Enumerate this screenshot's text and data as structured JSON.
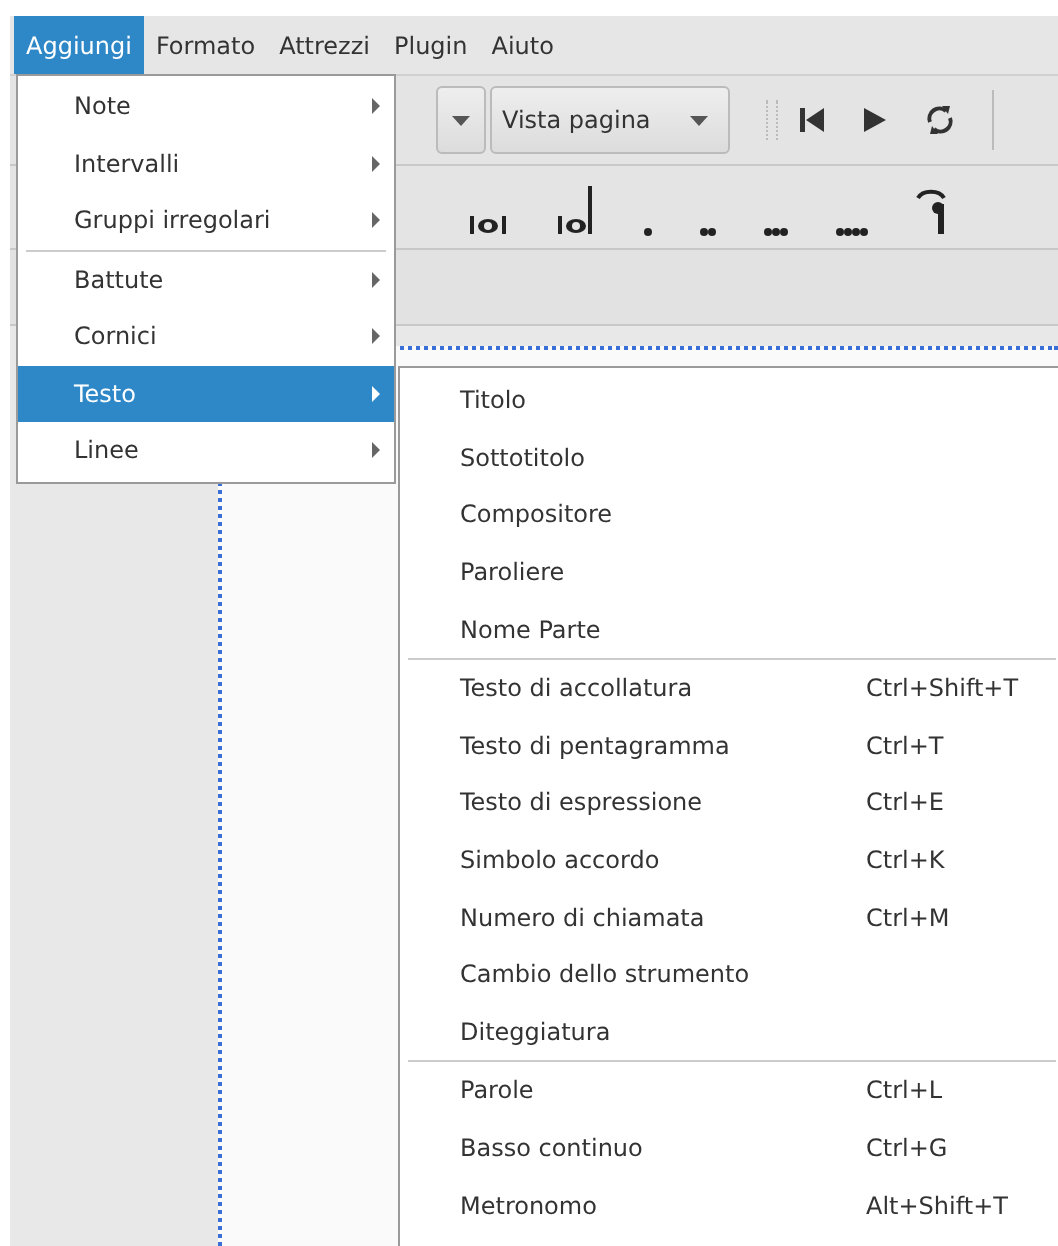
{
  "menubar": [
    {
      "label": "Aggiungi",
      "selected": true
    },
    {
      "label": "Formato",
      "selected": false
    },
    {
      "label": "Attrezzi",
      "selected": false
    },
    {
      "label": "Plugin",
      "selected": false
    },
    {
      "label": "Aiuto",
      "selected": false
    }
  ],
  "toolbar": {
    "view_mode": "Vista pagina"
  },
  "menu": {
    "sections": [
      {
        "items": [
          {
            "label": "Note",
            "selected": false
          },
          {
            "label": "Intervalli",
            "selected": false
          },
          {
            "label": "Gruppi irregolari",
            "selected": false
          }
        ]
      },
      {
        "items": [
          {
            "label": "Battute",
            "selected": false
          },
          {
            "label": "Cornici",
            "selected": false
          },
          {
            "label": "Testo",
            "selected": true
          },
          {
            "label": "Linee",
            "selected": false
          }
        ]
      }
    ]
  },
  "submenu": {
    "sections": [
      {
        "items": [
          {
            "label": "Titolo"
          },
          {
            "label": "Sottotitolo"
          },
          {
            "label": "Compositore"
          },
          {
            "label": "Paroliere"
          },
          {
            "label": "Nome Parte"
          }
        ]
      },
      {
        "items": [
          {
            "label": "Testo di accollatura",
            "shortcut": "Ctrl+Shift+T"
          },
          {
            "label": "Testo di pentagramma",
            "shortcut": "Ctrl+T"
          },
          {
            "label": "Testo di espressione",
            "shortcut": "Ctrl+E"
          },
          {
            "label": "Simbolo accordo",
            "shortcut": "Ctrl+K"
          },
          {
            "label": "Numero di chiamata",
            "shortcut": "Ctrl+M"
          },
          {
            "label": "Cambio dello strumento"
          },
          {
            "label": "Diteggiatura"
          }
        ]
      },
      {
        "items": [
          {
            "label": "Parole",
            "shortcut": "Ctrl+L"
          },
          {
            "label": "Basso continuo",
            "shortcut": "Ctrl+G"
          },
          {
            "label": "Metronomo",
            "shortcut": "Alt+Shift+T"
          }
        ]
      }
    ]
  }
}
